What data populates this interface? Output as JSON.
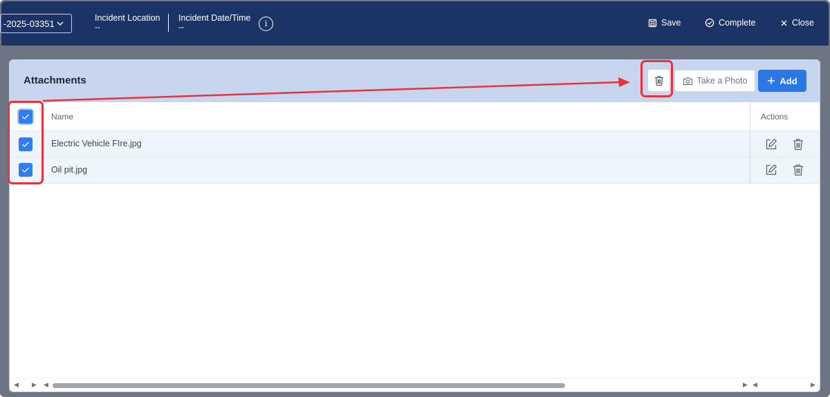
{
  "topbar": {
    "incident_id": "-2025-03351",
    "location_label": "Incident Location",
    "location_value": "--",
    "datetime_label": "Incident Date/Time",
    "datetime_value": "--",
    "info_glyph": "i",
    "save_label": "Save",
    "complete_label": "Complete",
    "close_label": "Close"
  },
  "attachments": {
    "title": "Attachments",
    "take_photo_label": "Take a Photo",
    "add_label": "Add",
    "columns": {
      "name": "Name",
      "actions": "Actions"
    },
    "select_all_checked": true,
    "rows": [
      {
        "name": "Electric Vehicle FIre.jpg",
        "checked": true
      },
      {
        "name": "Oil pit.jpg",
        "checked": true
      }
    ]
  },
  "colors": {
    "topbar_bg": "#1b3465",
    "panel_header_bg": "#c7d6ee",
    "accent": "#2b78e4",
    "row_bg": "#eef5fd",
    "annotation": "#e8323c"
  },
  "icons": [
    "chevron-down-icon",
    "info-icon",
    "save-icon",
    "check-circle-icon",
    "close-icon",
    "trash-icon",
    "camera-icon",
    "plus-icon",
    "edit-icon",
    "check-icon",
    "arrow-left-icon",
    "arrow-right-icon"
  ]
}
